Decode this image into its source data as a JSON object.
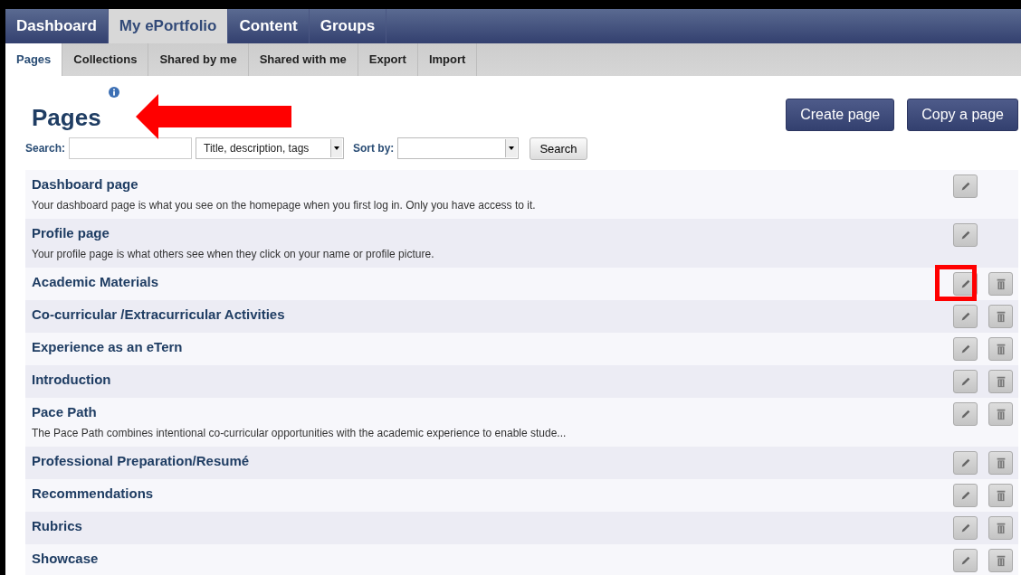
{
  "main_nav": [
    {
      "label": "Dashboard",
      "selected": false
    },
    {
      "label": "My ePortfolio",
      "selected": true
    },
    {
      "label": "Content",
      "selected": false
    },
    {
      "label": "Groups",
      "selected": false
    }
  ],
  "sub_nav": [
    {
      "label": "Pages",
      "selected": true
    },
    {
      "label": "Collections",
      "selected": false
    },
    {
      "label": "Shared by me",
      "selected": false
    },
    {
      "label": "Shared with me",
      "selected": false
    },
    {
      "label": "Export",
      "selected": false
    },
    {
      "label": "Import",
      "selected": false
    }
  ],
  "heading": "Pages",
  "header_buttons": [
    "Create page",
    "Copy a page"
  ],
  "search": {
    "label": "Search:",
    "scope": "Title, description, tags",
    "sort_label": "Sort by:",
    "button": "Search"
  },
  "pages": [
    {
      "title": "Dashboard page",
      "description": "Your dashboard page is what you see on the homepage when you first log in. Only you have access to it.",
      "deletable": false,
      "highlighted": false
    },
    {
      "title": "Profile page",
      "description": "Your profile page is what others see when they click on your name or profile picture.",
      "deletable": false,
      "highlighted": false
    },
    {
      "title": "Academic Materials",
      "deletable": true,
      "highlighted": true
    },
    {
      "title": "Co-curricular /Extracurricular Activities",
      "deletable": true,
      "highlighted": false
    },
    {
      "title": "Experience as an eTern",
      "deletable": true,
      "highlighted": false
    },
    {
      "title": "Introduction",
      "deletable": true,
      "highlighted": false
    },
    {
      "title": "Pace Path",
      "description": "The Pace Path combines intentional co-curricular opportunities with the academic experience to enable stude...",
      "deletable": true,
      "highlighted": false
    },
    {
      "title": "Professional Preparation/Resumé",
      "deletable": true,
      "highlighted": false
    },
    {
      "title": "Recommendations",
      "deletable": true,
      "highlighted": false
    },
    {
      "title": "Rubrics",
      "deletable": true,
      "highlighted": false
    },
    {
      "title": "Showcase",
      "deletable": true,
      "highlighted": false
    }
  ],
  "annotations": [
    {
      "kind": "arrow"
    }
  ]
}
